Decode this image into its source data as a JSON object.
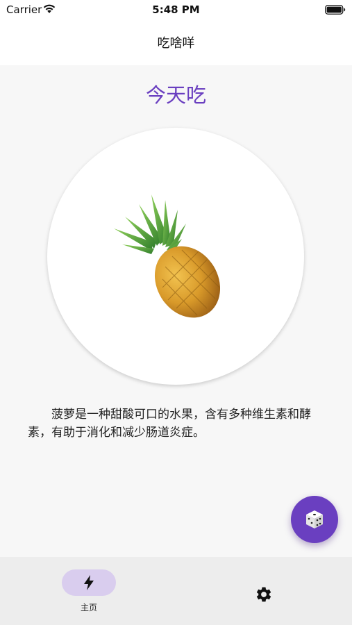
{
  "status_bar": {
    "carrier": "Carrier",
    "time": "5:48 PM"
  },
  "nav": {
    "title": "吃啥咩"
  },
  "main": {
    "heading": "今天吃",
    "food_icon": "pineapple",
    "description": "菠萝是一种甜酸可口的水果，含有多种维生素和酵素，有助于消化和减少肠道炎症。",
    "fab_icon": "dice-icon"
  },
  "tab_bar": {
    "items": [
      {
        "label": "主页",
        "icon": "bolt-icon",
        "selected": true
      },
      {
        "label": "",
        "icon": "gear-icon",
        "selected": false
      }
    ]
  },
  "colors": {
    "accent": "#6a3fc0",
    "tab_highlight": "#d9cdee",
    "tab_bar_bg": "#ededed"
  }
}
